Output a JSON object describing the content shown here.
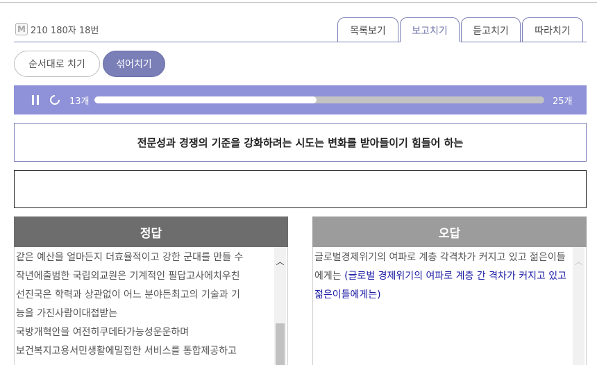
{
  "header": {
    "badge_letter": "M",
    "info_text": "210 180자 18번"
  },
  "tabs": [
    {
      "label": "목록보기",
      "active": false
    },
    {
      "label": "보고치기",
      "active": true
    },
    {
      "label": "듣고치기",
      "active": false
    },
    {
      "label": "따라치기",
      "active": false
    }
  ],
  "modes": {
    "sequential_label": "순서대로 치기",
    "shuffle_label": "섞어치기",
    "selected": "섞어치기"
  },
  "progress": {
    "current_label": "13개",
    "total_label": "25개",
    "current": 13,
    "total": 25
  },
  "prompt": {
    "sentence": "전문성과 경쟁의 기준을 강화하려는 시도는 변화를 받아들이기 힘들어 하는"
  },
  "answer": {
    "value": "",
    "placeholder": ""
  },
  "correct_panel": {
    "title": "정답",
    "items": [
      "같은 예산을 얼마든지 더효율적이고 강한 군대를 만들 수",
      "작년에출범한 국립외교원은 기계적인 필답고사에치우친",
      "선진국은 학력과 상관없이 어느 분야든최고의 기술과 기",
      "능을 가진사람이대접받는",
      "국방개혁안을 여전히쿠데타가능성운운하며",
      "보건복지고용서민생활에밀접한 서비스를 통합제공하고"
    ]
  },
  "wrong_panel": {
    "title": "오답",
    "typed_text": "글로벌경제위기의 여파로 계층 각격차가 커지고 있고 젊은이들에게는",
    "correction_text": "(글로벌 경제위기의 여파로 계층 간 격차가 커지고 있고 젊은이들에게는)"
  },
  "colors": {
    "accent": "#7b7fb8",
    "progress_bg": "#8f92d8",
    "correct_header": "#6d6d6d",
    "wrong_header": "#9c9c9c",
    "correction_text": "#1a1aa6"
  },
  "icons": {
    "pause": "pause-icon",
    "reload": "reload-icon",
    "scroll_up": "chevron-up-icon"
  }
}
